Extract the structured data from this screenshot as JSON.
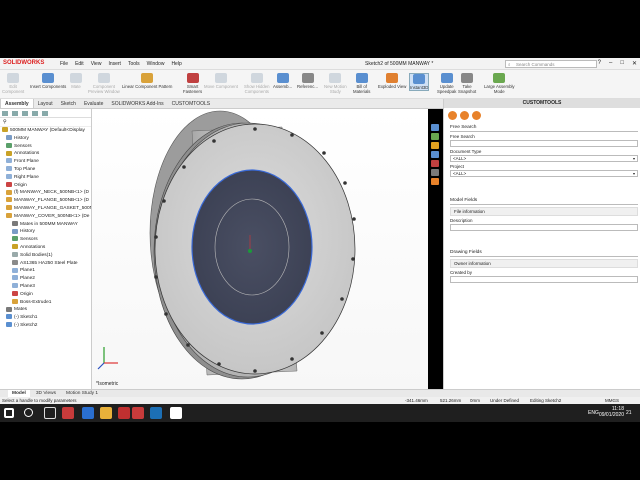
{
  "app": {
    "logo": "SOLIDWORKS",
    "menus": [
      "File",
      "Edit",
      "View",
      "Insert",
      "Tools",
      "Window",
      "Help"
    ],
    "title": "Sketch2 of 500MM MANWAY *",
    "search_placeholder": "Search Commands",
    "window_controls": [
      "?",
      "–",
      "□",
      "✕"
    ]
  },
  "commands": [
    {
      "label": "Edit\nComponent",
      "enabled": false
    },
    {
      "label": "Insert Components",
      "enabled": true
    },
    {
      "label": "Mate",
      "enabled": false
    },
    {
      "label": "Component\nPreview Window",
      "enabled": false
    },
    {
      "label": "Linear Component Pattern",
      "enabled": true
    },
    {
      "label": "Smart\nFasteners",
      "enabled": true
    },
    {
      "label": "Move Component",
      "enabled": false
    },
    {
      "label": "Show Hidden\nComponents",
      "enabled": false
    },
    {
      "label": "Assemb...",
      "enabled": true
    },
    {
      "label": "Referenc...",
      "enabled": true
    },
    {
      "label": "New Motion\nStudy",
      "enabled": false
    },
    {
      "label": "Bill of\nMaterials",
      "enabled": true
    },
    {
      "label": "Exploded View",
      "enabled": true
    },
    {
      "label": "Instant3D",
      "enabled": true
    },
    {
      "label": "Update\nSpeedpak",
      "enabled": true
    },
    {
      "label": "Take\nSnapshot",
      "enabled": true
    },
    {
      "label": "Large Assembly\nMode",
      "enabled": true
    }
  ],
  "tabs": [
    "Assembly",
    "Layout",
    "Sketch",
    "Evaluate",
    "SOLIDWORKS Add-Ins",
    "CUSTOMTOOLS"
  ],
  "active_tab": "Assembly",
  "tree": {
    "root": "500MM MANWAY  (Default<Display",
    "items": [
      {
        "label": "History",
        "indent": 1,
        "icon": "history-icon"
      },
      {
        "label": "Sensors",
        "indent": 1,
        "icon": "sensor-icon"
      },
      {
        "label": "Annotations",
        "indent": 1,
        "icon": "annotation-icon"
      },
      {
        "label": "Front Plane",
        "indent": 1,
        "icon": "plane-icon"
      },
      {
        "label": "Top Plane",
        "indent": 1,
        "icon": "plane-icon"
      },
      {
        "label": "Right Plane",
        "indent": 1,
        "icon": "plane-icon"
      },
      {
        "label": "Origin",
        "indent": 1,
        "icon": "origin-icon"
      },
      {
        "label": "(f) MANWAY_NECK_500NB<1> (D",
        "indent": 1,
        "icon": "part-icon"
      },
      {
        "label": "MANWAY_FLANGE_500NB<1> (D",
        "indent": 1,
        "icon": "part-icon"
      },
      {
        "label": "MANWAY_FLANGE_GASKET_500N",
        "indent": 1,
        "icon": "part-icon"
      },
      {
        "label": "MANWAY_COVER_500NB<1> (De",
        "indent": 1,
        "icon": "part-icon"
      },
      {
        "label": "Mates in 500MM MANWAY",
        "indent": 2,
        "icon": "mate-icon"
      },
      {
        "label": "History",
        "indent": 2,
        "icon": "history-icon"
      },
      {
        "label": "Sensors",
        "indent": 2,
        "icon": "sensor-icon"
      },
      {
        "label": "Annotations",
        "indent": 2,
        "icon": "annotation-icon"
      },
      {
        "label": "Solid Bodies(1)",
        "indent": 2,
        "icon": "body-icon"
      },
      {
        "label": "AS1365 HA250 Steel Plate",
        "indent": 2,
        "icon": "material-icon"
      },
      {
        "label": "Plane1",
        "indent": 2,
        "icon": "plane-icon"
      },
      {
        "label": "Plane2",
        "indent": 2,
        "icon": "plane-icon"
      },
      {
        "label": "Plane3",
        "indent": 2,
        "icon": "plane-icon"
      },
      {
        "label": "Origin",
        "indent": 2,
        "icon": "origin-icon"
      },
      {
        "label": "Boss-Extrude1",
        "indent": 2,
        "icon": "extrude-icon"
      },
      {
        "label": "Mates",
        "indent": 1,
        "icon": "mate-icon"
      },
      {
        "label": "(-) Sketch1",
        "indent": 1,
        "icon": "sketch-icon"
      },
      {
        "label": "(-) Sketch2",
        "indent": 1,
        "icon": "sketch-icon"
      }
    ]
  },
  "viewport": {
    "view_label": "*Isometric"
  },
  "task_pane": {
    "title": "CUSTOMTOOLS",
    "free_search_section": "Free Search",
    "free_search_label": "Free Search",
    "document_type_label": "Document Type",
    "document_type_value": "<ALL>",
    "project_label": "Project",
    "project_value": "<ALL>",
    "model_fields_section": "Model Fields",
    "file_information": "File information",
    "description_label": "Description",
    "drawing_fields_section": "Drawing Fields",
    "owner_information": "Owner information",
    "created_by_label": "Created by"
  },
  "bottom_tabs": [
    "Model",
    "3D Views",
    "Motion Study 1"
  ],
  "active_bottom_tab": "Model",
  "status": {
    "message": "Select a handle to modify parameters",
    "x": "-341.46mm",
    "y": "521.26mm",
    "z": "0mm",
    "state": "Under Defined",
    "editing": "Editing Sketch2",
    "units": "MMGS"
  },
  "taskbar": {
    "time": "11:18",
    "date": "09/01/2020",
    "lang": "ENG",
    "notifications": "21"
  }
}
